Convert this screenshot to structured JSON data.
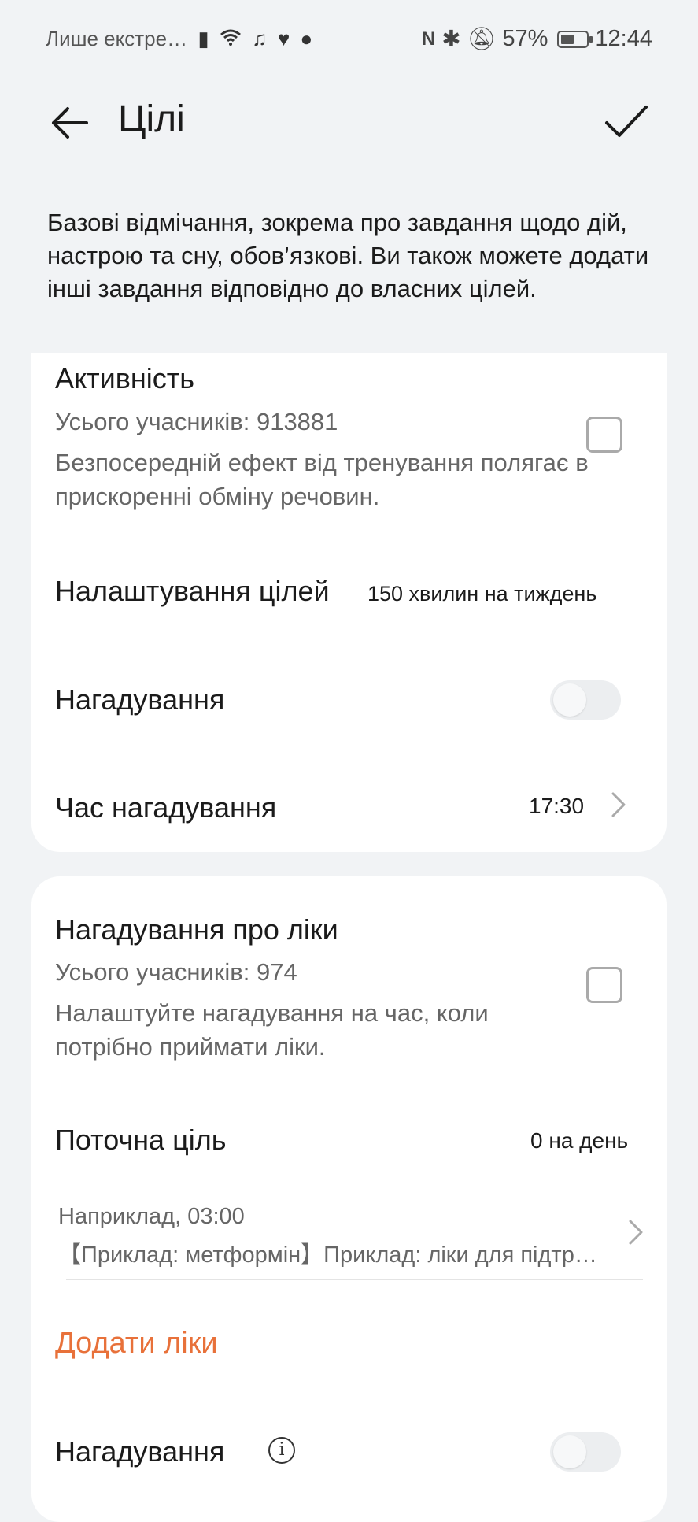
{
  "status_bar": {
    "carrier": "Лише екстре…",
    "icons": [
      "sim-icon",
      "wifi-icon",
      "music-icon",
      "heart-icon",
      "chat-icon"
    ],
    "right_icons": [
      "nfc-icon",
      "bluetooth-icon",
      "mute-icon"
    ],
    "battery": "57%",
    "battery_level": 0.57,
    "time": "12:44"
  },
  "header": {
    "title": "Цілі"
  },
  "intro": "Базові відмічання, зокрема про завдання щодо дій, настрою та сну, обов’язкові. Ви також можете додати інші завдання відповідно до власних цілей.",
  "activity": {
    "title": "Активність",
    "participants": "Усього учасників: 913881",
    "description": "Безпосередній ефект від тренування полягає в прискоренні обміну речовин.",
    "goal_label": "Налаштування цілей",
    "goal_value": "150 хвилин на тиждень",
    "reminder_label": "Нагадування",
    "reminder_on": false,
    "reminder_time_label": "Час нагадування",
    "reminder_time_value": "17:30"
  },
  "medication": {
    "title": "Нагадування про ліки",
    "participants": "Усього учасників: 974",
    "description": "Налаштуйте нагадування на час, коли потрібно приймати ліки.",
    "current_goal_label": "Поточна ціль",
    "current_goal_value": "0 на день",
    "example_time": "Наприклад, 03:00",
    "example_names": "【Приклад: метформін】Приклад: ліки для підтр…",
    "add_label": "Додати ліки",
    "reminder_label": "Нагадування",
    "reminder_on": false
  },
  "colors": {
    "accent": "#e8713a",
    "background": "#f1f3f5",
    "card": "#ffffff"
  }
}
